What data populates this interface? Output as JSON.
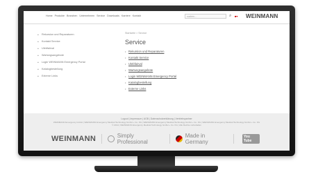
{
  "topnav": {
    "links": [
      "Home",
      "Produkte",
      "Branchen",
      "Unternehmen",
      "Service",
      "Downloads",
      "Karriere",
      "Kontakt"
    ],
    "search_placeholder": "suchen...",
    "logo": "WEINMANN"
  },
  "sidebar": {
    "items": [
      "Rekursion und Reparaturen",
      "Kontakt Service",
      "Ulebfairval",
      "Wartungsangebote",
      "Login WEINMANN Emergency Portal",
      "Katalogbestellung",
      "Externe Links"
    ]
  },
  "main": {
    "breadcrumb": "Startseite > Service",
    "title": "Service",
    "links": [
      "Rekursion und Reparaturen",
      "Kontakt Service",
      "Ulebfairval",
      "Wartungsangebote",
      "Login WEINMANN Emergency Portal",
      "Katalogbestellung",
      "Externe Links"
    ]
  },
  "footer": {
    "line1": "Logout | Impressum | AGB | Datenschutzerklärung | Vertriebspartner",
    "line2": "WEINMANN Emergency GmbH | WEINMANN Emergency Medical Technology GmbH + Co. KG | WEINMANN Emergency Medical Technology GmbH + Co. KG | WEINMANN Emergency Medical Technology GmbH + Co. KG",
    "line3": "© 2014 | WEINMANN Emergency Medical Technology GmbH + Co. KG | Alle Rechte vorbehalten",
    "brand": "WEINMANN",
    "tagline": "Simply Professional",
    "made_in": "Made in Germany",
    "youtube": "You Tube"
  }
}
